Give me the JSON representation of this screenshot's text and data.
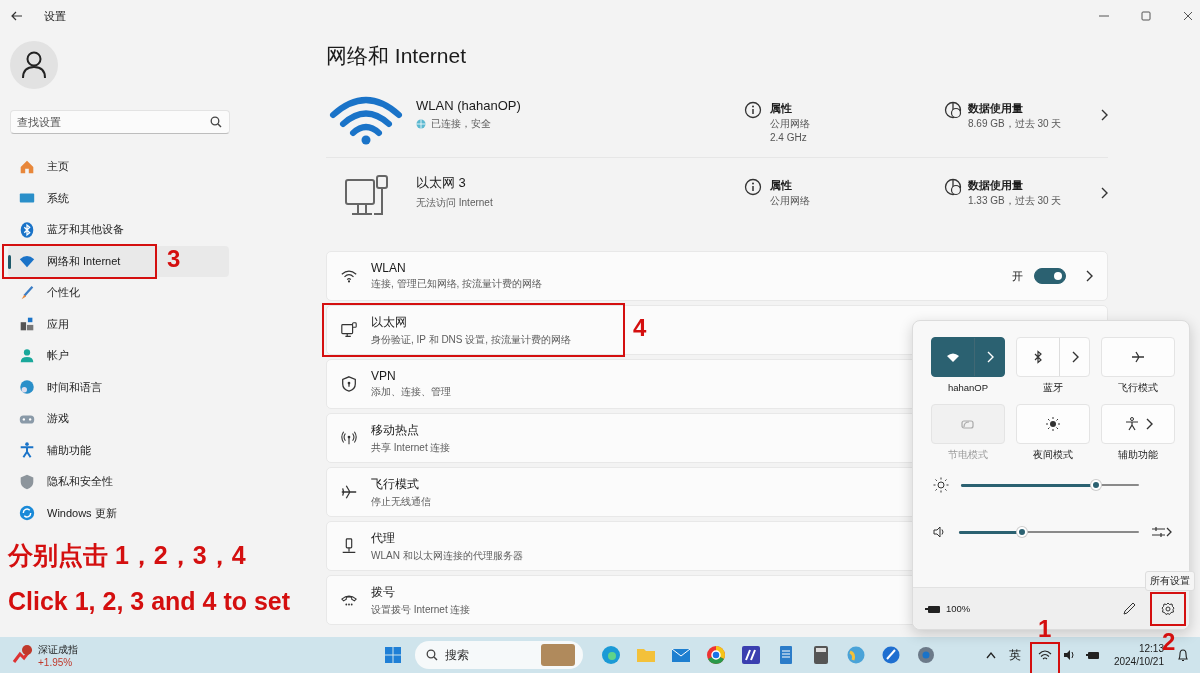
{
  "window": {
    "title": "设置"
  },
  "sidebar": {
    "search": {
      "placeholder": "查找设置"
    },
    "items": [
      {
        "kind": "home",
        "label": "主页",
        "selected": false
      },
      {
        "kind": "system",
        "label": "系统",
        "selected": false
      },
      {
        "kind": "bluetooth",
        "label": "蓝牙和其他设备",
        "selected": false
      },
      {
        "kind": "network",
        "label": "网络和 Internet",
        "selected": true,
        "annotation": "3"
      },
      {
        "kind": "personalize",
        "label": "个性化",
        "selected": false
      },
      {
        "kind": "apps",
        "label": "应用",
        "selected": false
      },
      {
        "kind": "accounts",
        "label": "帐户",
        "selected": false
      },
      {
        "kind": "time",
        "label": "时间和语言",
        "selected": false
      },
      {
        "kind": "gaming",
        "label": "游戏",
        "selected": false
      },
      {
        "kind": "accessibility",
        "label": "辅助功能",
        "selected": false
      },
      {
        "kind": "privacy",
        "label": "隐私和安全性",
        "selected": false
      },
      {
        "kind": "update",
        "label": "Windows 更新",
        "selected": false
      }
    ]
  },
  "page_title": "网络和 Internet",
  "connections": [
    {
      "kind": "wifi",
      "name": "WLAN (hahanOP)",
      "status": "已连接，安全",
      "connected": true,
      "properties": {
        "label": "属性",
        "lines": [
          "公用网络",
          "2.4 GHz"
        ]
      },
      "usage": {
        "label": "数据使用量",
        "value": "8.69 GB，过去 30 天"
      }
    },
    {
      "kind": "ethernet",
      "name": "以太网 3",
      "status": "无法访问 Internet",
      "connected": false,
      "properties": {
        "label": "属性",
        "lines": [
          "公用网络"
        ]
      },
      "usage": {
        "label": "数据使用量",
        "value": "1.33 GB，过去 30 天"
      }
    }
  ],
  "settings_rows": [
    {
      "kind": "wifi",
      "title": "WLAN",
      "subtitle": "连接, 管理已知网络, 按流量计费的网络",
      "toggle": {
        "label": "开",
        "on": true
      },
      "chevron": true
    },
    {
      "kind": "ethernet",
      "title": "以太网",
      "subtitle": "身份验证, IP 和 DNS 设置, 按流量计费的网络",
      "annotation": "4"
    },
    {
      "kind": "vpn",
      "title": "VPN",
      "subtitle": "添加、连接、管理"
    },
    {
      "kind": "hotspot",
      "title": "移动热点",
      "subtitle": "共享 Internet 连接"
    },
    {
      "kind": "airplane",
      "title": "飞行模式",
      "subtitle": "停止无线通信"
    },
    {
      "kind": "proxy",
      "title": "代理",
      "subtitle": "WLAN 和以太网连接的代理服务器"
    },
    {
      "kind": "dialup",
      "title": "拨号",
      "subtitle": "设置拨号 Internet 连接"
    }
  ],
  "quick_settings": {
    "tiles": [
      {
        "kind": "wifi",
        "label": "hahanOP",
        "on": true,
        "disabled": false,
        "split": true,
        "arrow": false
      },
      {
        "kind": "bluetooth",
        "label": "蓝牙",
        "on": false,
        "disabled": false,
        "split": true,
        "arrow": false
      },
      {
        "kind": "airplane",
        "label": "飞行模式",
        "on": false,
        "disabled": false,
        "split": false,
        "arrow": false
      },
      {
        "kind": "battery_saver",
        "label": "节电模式",
        "on": false,
        "disabled": true,
        "split": false,
        "arrow": false
      },
      {
        "kind": "night_light",
        "label": "夜间模式",
        "on": false,
        "disabled": false,
        "split": false,
        "arrow": false
      },
      {
        "kind": "accessibility",
        "label": "辅助功能",
        "on": false,
        "disabled": false,
        "split": false,
        "arrow": true
      }
    ],
    "brightness": {
      "level": 0.76
    },
    "volume": {
      "level": 0.35
    },
    "battery": "100%",
    "all_settings": {
      "tooltip": "所有设置",
      "annotation": "2"
    }
  },
  "taskbar": {
    "widget": {
      "title": "深证成指",
      "value": "+1.95%"
    },
    "search": {
      "placeholder": "搜索"
    },
    "tray": {
      "input_indicator": "英",
      "network_annotation": "1",
      "time": "12:13",
      "date": "2024/10/21"
    }
  },
  "instructions": [
    "分别点击 1，2，3，4",
    "Click 1, 2, 3 and 4 to set"
  ]
}
